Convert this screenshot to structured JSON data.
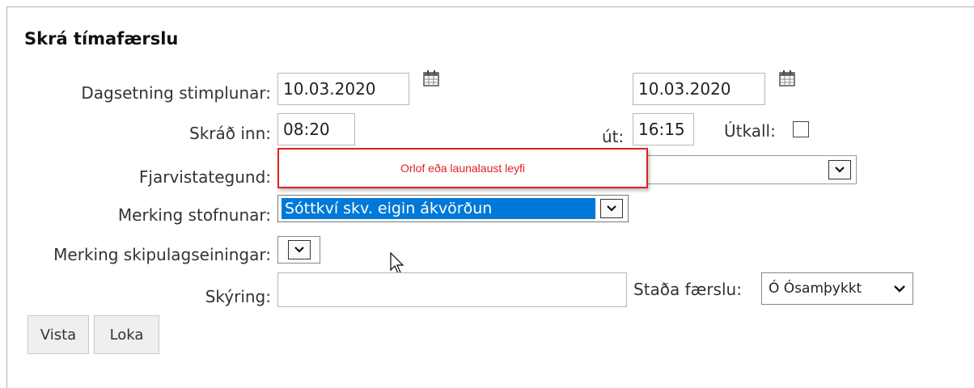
{
  "form": {
    "title": "Skrá tímafærslu",
    "date": {
      "label": "Dagsetning stimplunar:",
      "start_value": "10.03.2020",
      "end_value": "10.03.2020",
      "calendar_icon": "calendar-icon"
    },
    "time": {
      "in_label": "Skráð inn:",
      "in_value": "08:20",
      "out_label": "út:",
      "out_value": "16:15",
      "callout_label": "Útkall:",
      "callout_checked": false
    },
    "absence_type": {
      "label": "Fjarvistategund:",
      "popup_text": "Orlof eða launalaust leyfi",
      "popup_color": "#e02020"
    },
    "institution_marking": {
      "label": "Merking stofnunar:",
      "selected": "Sóttkví skv. eigin ákvörðun",
      "highlight_color": "#0078d7"
    },
    "unit_marking": {
      "label": "Merking skipulagseiningar:"
    },
    "explanation": {
      "label": "Skýring:",
      "value": ""
    },
    "status": {
      "label": "Staða færslu:",
      "selected": "Ó Ósamþykkt"
    },
    "buttons": {
      "save": "Vista",
      "close": "Loka"
    }
  }
}
